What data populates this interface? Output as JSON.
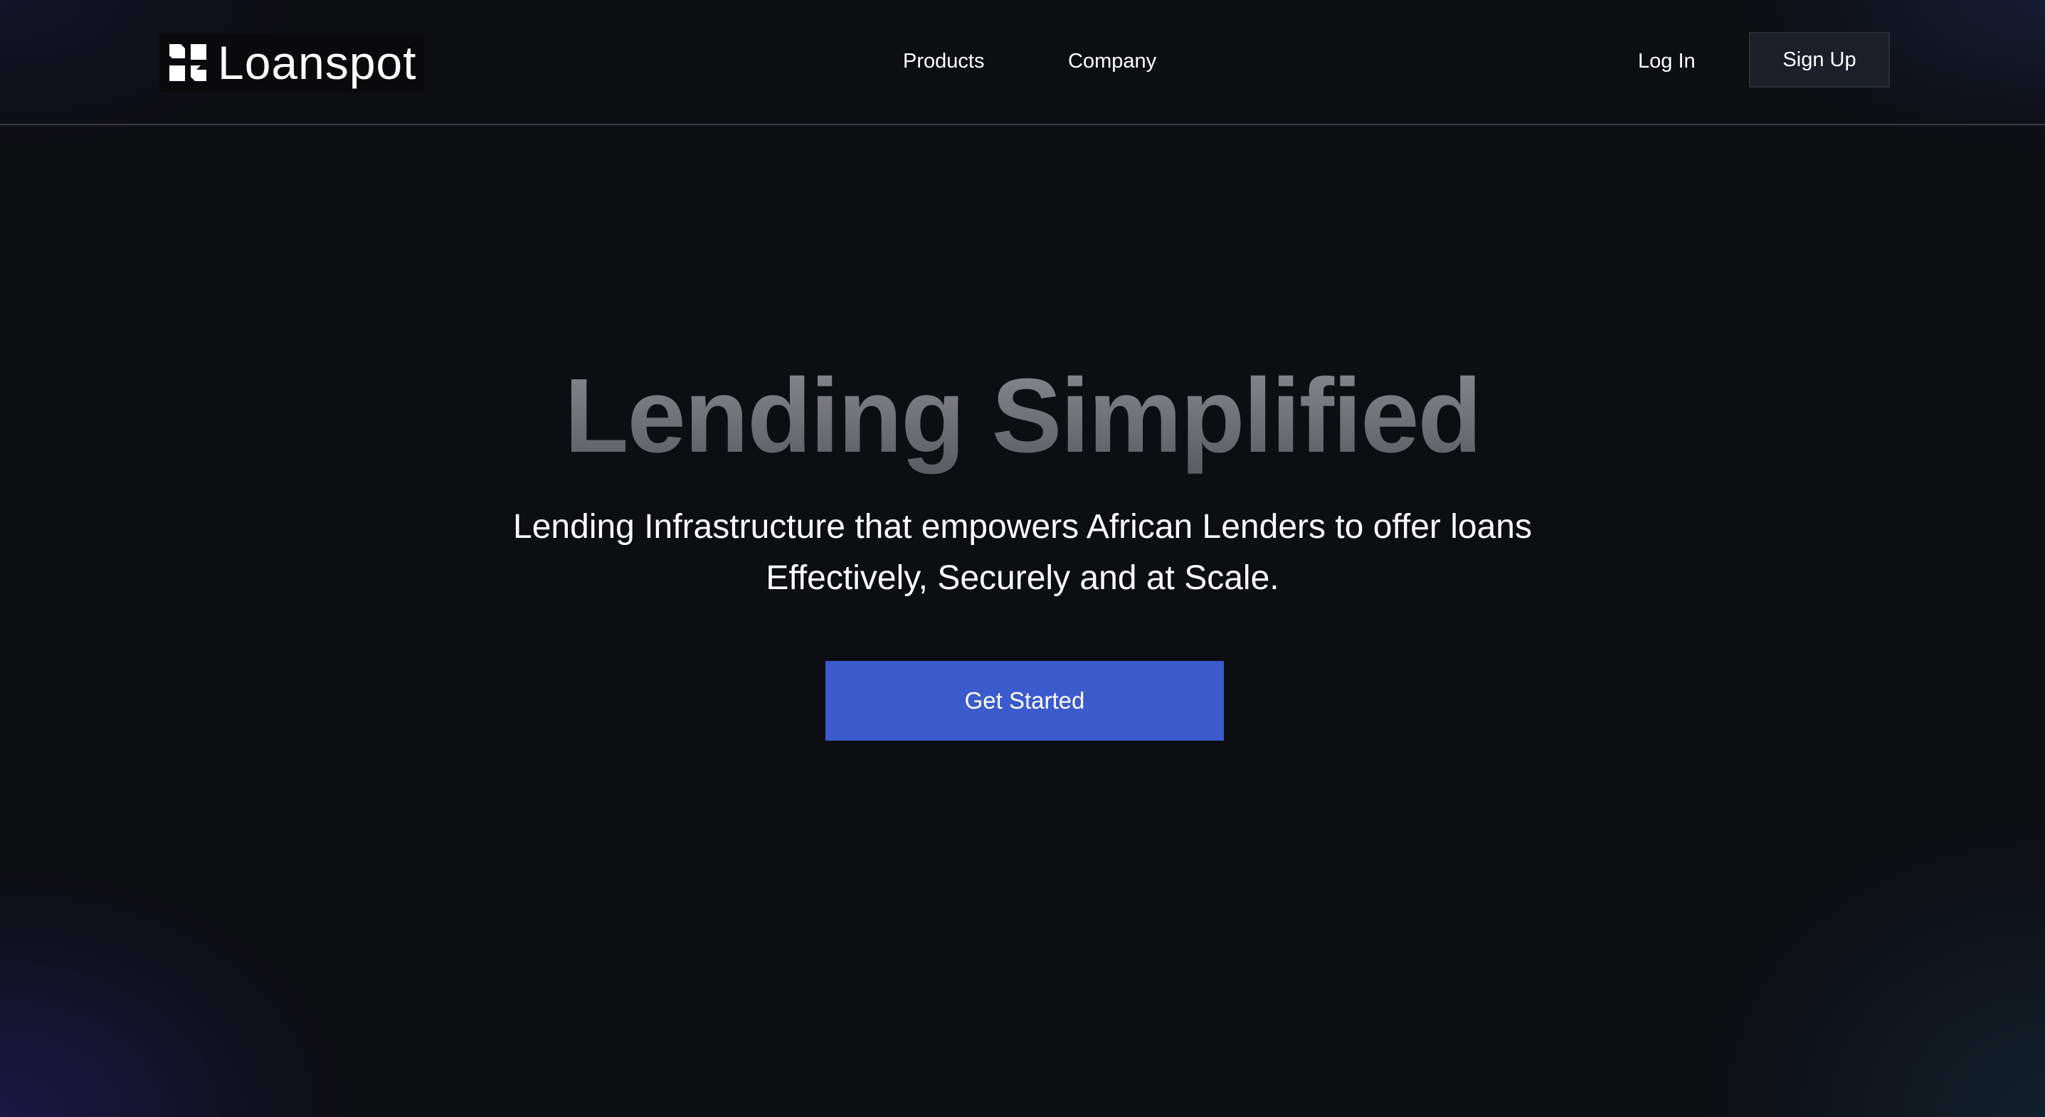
{
  "header": {
    "logo_text": "Loanspot",
    "nav": {
      "products_label": "Products",
      "company_label": "Company"
    },
    "login_label": "Log In",
    "signup_label": "Sign Up"
  },
  "hero": {
    "title": "Lending Simplified",
    "subtitle_line1": "Lending Infrastructure that empowers African Lenders to offer loans",
    "subtitle_line2": "Effectively, Securely and at Scale.",
    "cta_label": "Get Started"
  },
  "colors": {
    "background": "#0d0e12",
    "cta": "#3b5bcc",
    "signup_button": "#1c1f29",
    "title_gray": "#6e6f74"
  },
  "icons": {
    "logo": "loanspot-logo-icon"
  }
}
